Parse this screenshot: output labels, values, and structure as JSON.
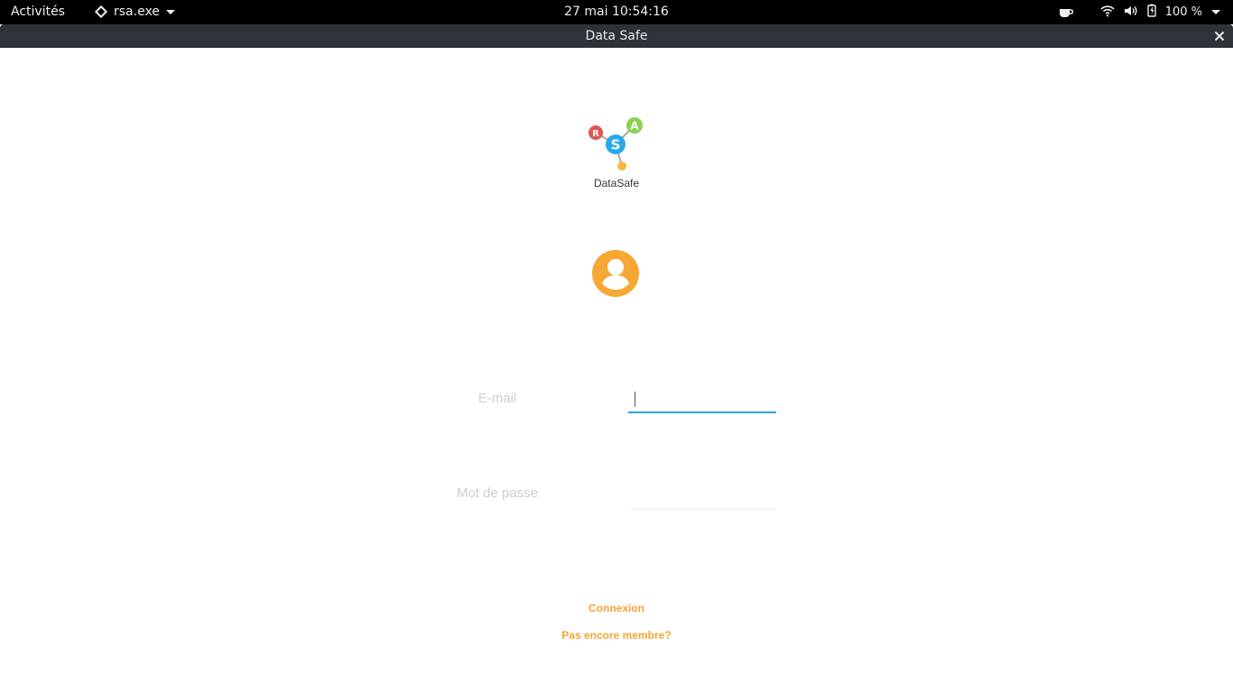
{
  "topbar": {
    "activities": "Activités",
    "app_name": "rsa.exe",
    "clock": "27 mai  10:54:16",
    "battery": "100 %"
  },
  "window": {
    "title": "Data Safe"
  },
  "app": {
    "brand": "DataSafe",
    "logo_letters": {
      "r": "R",
      "s": "S",
      "a": "A"
    },
    "email_label": "E-mail",
    "email_value": "",
    "password_label": "Mot de passe",
    "password_value": "",
    "login_link": "Connexion",
    "signup_link": "Pas encore membre?"
  },
  "colors": {
    "accent": "#f5a533",
    "input_focus": "#29a9d6",
    "logo_red": "#e05555",
    "logo_blue": "#29a9e8",
    "logo_green": "#8cd04f",
    "logo_yellow": "#f5b83a"
  }
}
